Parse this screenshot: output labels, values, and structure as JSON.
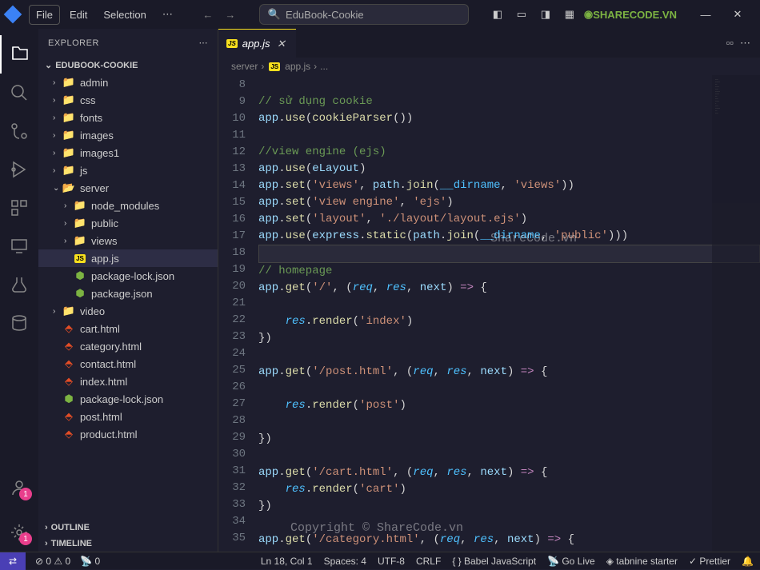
{
  "menu": {
    "file": "File",
    "edit": "Edit",
    "selection": "Selection"
  },
  "search_placeholder": "EduBook-Cookie",
  "logo_text": "SHARECODE.VN",
  "explorer": {
    "title": "EXPLORER",
    "project": "EDUBOOK-COOKIE",
    "outline": "OUTLINE",
    "timeline": "TIMELINE"
  },
  "tree": {
    "admin": "admin",
    "css": "css",
    "fonts": "fonts",
    "images": "images",
    "images1": "images1",
    "js": "js",
    "server": "server",
    "node_modules": "node_modules",
    "public": "public",
    "views": "views",
    "appjs": "app.js",
    "pkglock": "package-lock.json",
    "pkg": "package.json",
    "video": "video",
    "cart": "cart.html",
    "category": "category.html",
    "contact": "contact.html",
    "index": "index.html",
    "pkglock2": "package-lock.json",
    "post": "post.html",
    "product": "product.html"
  },
  "tab": {
    "name": "app.js"
  },
  "breadcrumb": {
    "p1": "server",
    "p2": "app.js",
    "p3": "..."
  },
  "code_lines": [
    {
      "n": "8",
      "html": ""
    },
    {
      "n": "9",
      "html": "<span class='c-comment'>// sử dụng cookie</span>"
    },
    {
      "n": "10",
      "html": "<span class='c-var'>app</span><span class='c-punct'>.</span><span class='c-method'>use</span><span class='c-punct'>(</span><span class='c-method'>cookieParser</span><span class='c-punct'>())</span>"
    },
    {
      "n": "11",
      "html": ""
    },
    {
      "n": "12",
      "html": "<span class='c-comment'>//view engine (ejs)</span>"
    },
    {
      "n": "13",
      "html": "<span class='c-var'>app</span><span class='c-punct'>.</span><span class='c-method'>use</span><span class='c-punct'>(</span><span class='c-var'>eLayout</span><span class='c-punct'>)</span>"
    },
    {
      "n": "14",
      "html": "<span class='c-var'>app</span><span class='c-punct'>.</span><span class='c-method'>set</span><span class='c-punct'>(</span><span class='c-string'>'views'</span><span class='c-punct'>, </span><span class='c-var'>path</span><span class='c-punct'>.</span><span class='c-method'>join</span><span class='c-punct'>(</span><span class='c-prop'>__dirname</span><span class='c-punct'>, </span><span class='c-string'>'views'</span><span class='c-punct'>))</span>"
    },
    {
      "n": "15",
      "html": "<span class='c-var'>app</span><span class='c-punct'>.</span><span class='c-method'>set</span><span class='c-punct'>(</span><span class='c-string'>'view engine'</span><span class='c-punct'>, </span><span class='c-string'>'ejs'</span><span class='c-punct'>)</span>"
    },
    {
      "n": "16",
      "html": "<span class='c-var'>app</span><span class='c-punct'>.</span><span class='c-method'>set</span><span class='c-punct'>(</span><span class='c-string'>'layout'</span><span class='c-punct'>, </span><span class='c-string'>'./layout/layout.ejs'</span><span class='c-punct'>)</span>"
    },
    {
      "n": "17",
      "html": "<span class='c-var'>app</span><span class='c-punct'>.</span><span class='c-method'>use</span><span class='c-punct'>(</span><span class='c-var'>express</span><span class='c-punct'>.</span><span class='c-method'>static</span><span class='c-punct'>(</span><span class='c-var'>path</span><span class='c-punct'>.</span><span class='c-method'>join</span><span class='c-punct'>(</span><span class='c-prop'>__dirname</span><span class='c-punct'>, </span><span class='c-string'>'public'</span><span class='c-punct'>)))</span>"
    },
    {
      "n": "18",
      "html": "",
      "hl": true
    },
    {
      "n": "19",
      "html": "<span class='c-comment'>// homepage</span>"
    },
    {
      "n": "20",
      "html": "<span class='c-var'>app</span><span class='c-punct'>.</span><span class='c-method'>get</span><span class='c-punct'>(</span><span class='c-string'>'/'</span><span class='c-punct'>, (</span><span class='c-param'>req</span><span class='c-punct'>, </span><span class='c-param'>res</span><span class='c-punct'>, </span><span class='c-var'>next</span><span class='c-punct'>) </span><span class='c-keyword'>=></span><span class='c-punct'> {</span>"
    },
    {
      "n": "21",
      "html": ""
    },
    {
      "n": "22",
      "html": "    <span class='c-param'>res</span><span class='c-punct'>.</span><span class='c-method'>render</span><span class='c-punct'>(</span><span class='c-string'>'index'</span><span class='c-punct'>)</span>"
    },
    {
      "n": "23",
      "html": "<span class='c-punct'>})</span>"
    },
    {
      "n": "24",
      "html": ""
    },
    {
      "n": "25",
      "html": "<span class='c-var'>app</span><span class='c-punct'>.</span><span class='c-method'>get</span><span class='c-punct'>(</span><span class='c-string'>'/post.html'</span><span class='c-punct'>, (</span><span class='c-param'>req</span><span class='c-punct'>, </span><span class='c-param'>res</span><span class='c-punct'>, </span><span class='c-var'>next</span><span class='c-punct'>) </span><span class='c-keyword'>=></span><span class='c-punct'> {</span>"
    },
    {
      "n": "26",
      "html": ""
    },
    {
      "n": "27",
      "html": "    <span class='c-param'>res</span><span class='c-punct'>.</span><span class='c-method'>render</span><span class='c-punct'>(</span><span class='c-string'>'post'</span><span class='c-punct'>)</span>"
    },
    {
      "n": "28",
      "html": ""
    },
    {
      "n": "29",
      "html": "<span class='c-punct'>})</span>"
    },
    {
      "n": "30",
      "html": ""
    },
    {
      "n": "31",
      "html": "<span class='c-var'>app</span><span class='c-punct'>.</span><span class='c-method'>get</span><span class='c-punct'>(</span><span class='c-string'>'/cart.html'</span><span class='c-punct'>, (</span><span class='c-param'>req</span><span class='c-punct'>, </span><span class='c-param'>res</span><span class='c-punct'>, </span><span class='c-var'>next</span><span class='c-punct'>) </span><span class='c-keyword'>=></span><span class='c-punct'> {</span>"
    },
    {
      "n": "32",
      "html": "    <span class='c-param'>res</span><span class='c-punct'>.</span><span class='c-method'>render</span><span class='c-punct'>(</span><span class='c-string'>'cart'</span><span class='c-punct'>)</span>"
    },
    {
      "n": "33",
      "html": "<span class='c-punct'>})</span>"
    },
    {
      "n": "34",
      "html": ""
    },
    {
      "n": "35",
      "html": "<span class='c-var'>app</span><span class='c-punct'>.</span><span class='c-method'>get</span><span class='c-punct'>(</span><span class='c-string'>'/category.html'</span><span class='c-punct'>, (</span><span class='c-param'>req</span><span class='c-punct'>, </span><span class='c-param'>res</span><span class='c-punct'>, </span><span class='c-var'>next</span><span class='c-punct'>) </span><span class='c-keyword'>=></span><span class='c-punct'> {</span>"
    }
  ],
  "statusbar": {
    "errors": "0",
    "warnings": "0",
    "port": "0",
    "lncol": "Ln 18, Col 1",
    "spaces": "Spaces: 4",
    "encoding": "UTF-8",
    "eol": "CRLF",
    "lang": "{ } Babel JavaScript",
    "golive": "Go Live",
    "tabnine": "tabnine starter",
    "prettier": "Prettier"
  },
  "badges": {
    "account": "1",
    "settings": "1"
  },
  "watermark1": "ShareCode.vn",
  "watermark2": "Copyright © ShareCode.vn"
}
